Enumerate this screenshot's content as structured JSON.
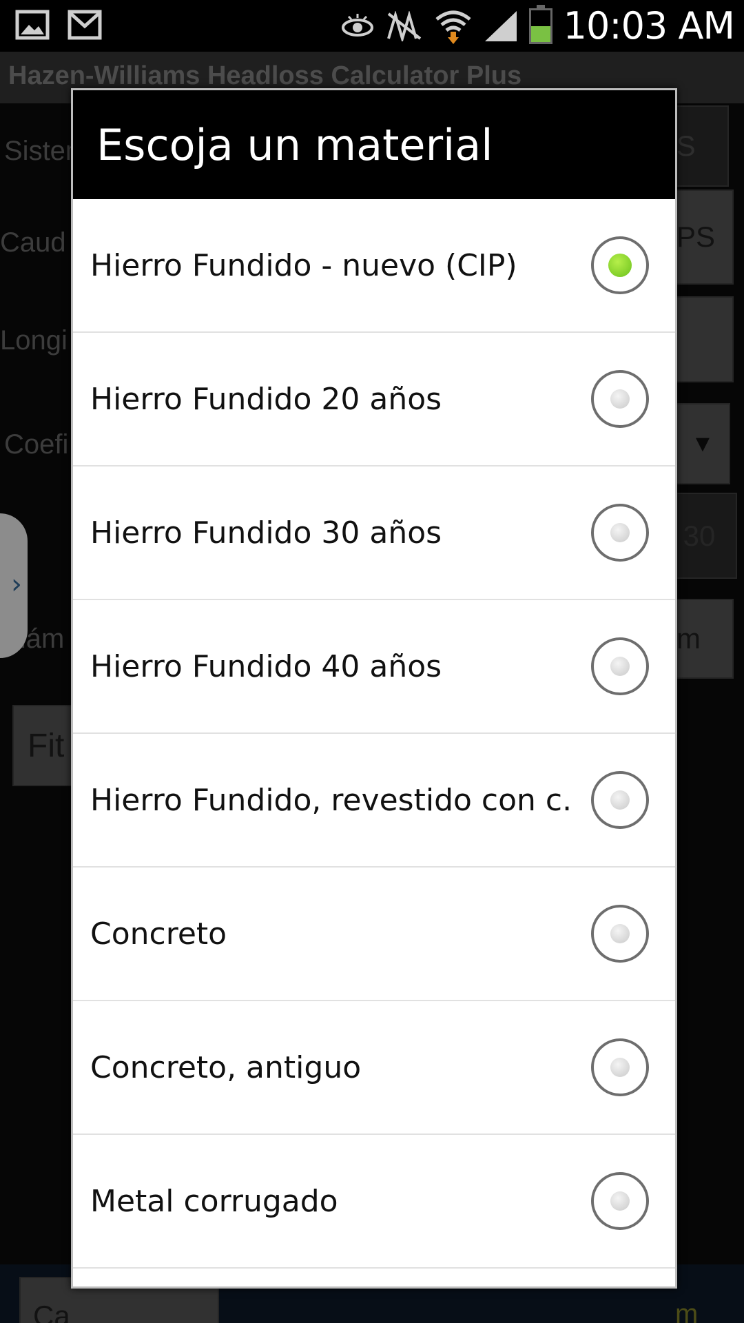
{
  "status_bar": {
    "time": "10:03 AM",
    "icons": [
      "gallery-icon",
      "gmail-icon",
      "eye-icon",
      "no-signal-icon",
      "wifi-icon",
      "cellular-signal-icon",
      "battery-icon"
    ]
  },
  "app": {
    "title": "Hazen-Williams Headloss Calculator Plus",
    "fragments": {
      "sistema": "Sistem",
      "caudal": "Caud",
      "longitud": "Longi",
      "coeficiente": "Coefi",
      "diametro": "Diám",
      "si_button": "SI",
      "us_button": "US",
      "gps_unit": "PS",
      "c_value": "30",
      "diameter_unit": "m",
      "fittings_button": "Fit",
      "calculate_button": "Ca",
      "bottom_text": "m"
    }
  },
  "dialog": {
    "title": "Escoja un material",
    "options": [
      {
        "label": "Hierro Fundido - nuevo (CIP)",
        "checked": true
      },
      {
        "label": "Hierro Fundido 20 años",
        "checked": false
      },
      {
        "label": "Hierro Fundido 30 años",
        "checked": false
      },
      {
        "label": "Hierro Fundido 40 años",
        "checked": false
      },
      {
        "label": "Hierro Fundido, revestido con c.",
        "checked": false
      },
      {
        "label": "Concreto",
        "checked": false
      },
      {
        "label": "Concreto, antiguo",
        "checked": false
      },
      {
        "label": "Metal corrugado",
        "checked": false
      }
    ]
  }
}
